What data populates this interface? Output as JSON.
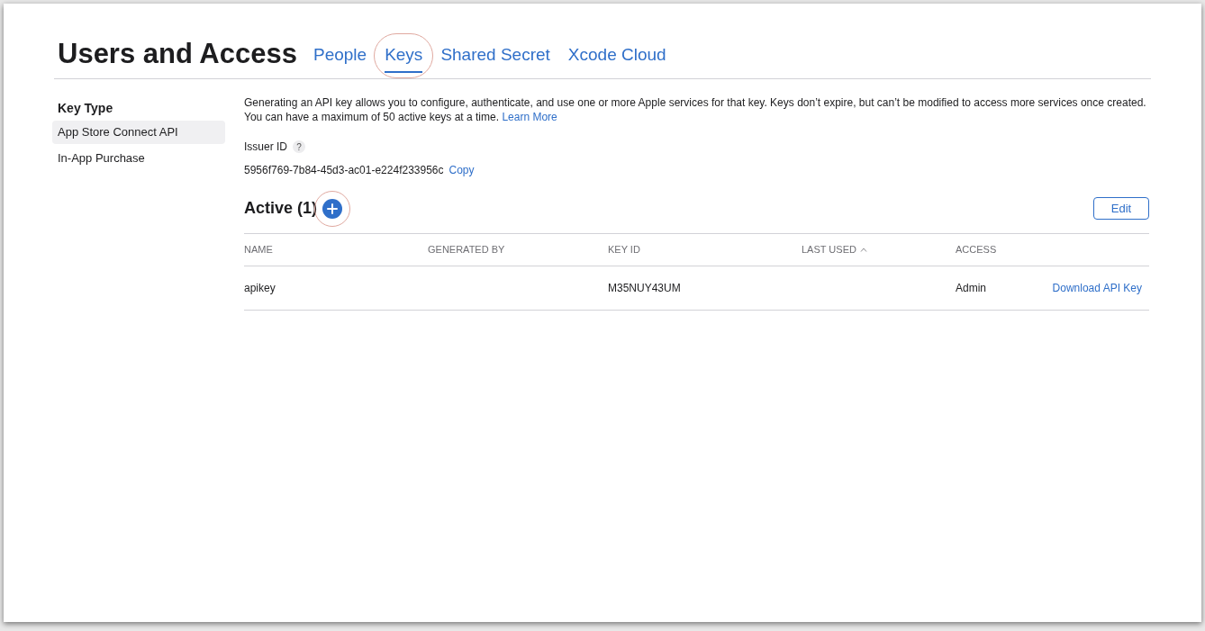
{
  "page": {
    "title": "Users and Access"
  },
  "tabs": [
    {
      "label": "People",
      "selected": false,
      "highlighted": false
    },
    {
      "label": "Keys",
      "selected": true,
      "highlighted": true
    },
    {
      "label": "Shared Secret",
      "selected": false,
      "highlighted": false
    },
    {
      "label": "Xcode Cloud",
      "selected": false,
      "highlighted": false
    }
  ],
  "sidebar": {
    "heading": "Key Type",
    "items": [
      {
        "label": "App Store Connect API",
        "selected": true
      },
      {
        "label": "In-App Purchase",
        "selected": false
      }
    ]
  },
  "intro": {
    "text": "Generating an API key allows you to configure, authenticate, and use one or more Apple services for that key. Keys don’t expire, but can’t be modified to access more services once created. You can have a maximum of 50 active keys at a time.",
    "link": "Learn More"
  },
  "issuer": {
    "label": "Issuer ID",
    "help": "?",
    "value": "5956f769-7b84-45d3-ac01-e224f233956c",
    "copy": "Copy"
  },
  "section": {
    "title": "Active (1)",
    "add_highlighted": true,
    "edit": "Edit"
  },
  "table": {
    "columns": [
      {
        "label": "NAME",
        "sorted": false
      },
      {
        "label": "GENERATED BY",
        "sorted": false
      },
      {
        "label": "KEY ID",
        "sorted": false
      },
      {
        "label": "LAST USED",
        "sorted": true
      },
      {
        "label": "ACCESS",
        "sorted": false
      }
    ],
    "rows": [
      {
        "name": "apikey",
        "key_id": "M35NUY43UM",
        "access": "Admin",
        "action": "Download API Key"
      }
    ]
  }
}
